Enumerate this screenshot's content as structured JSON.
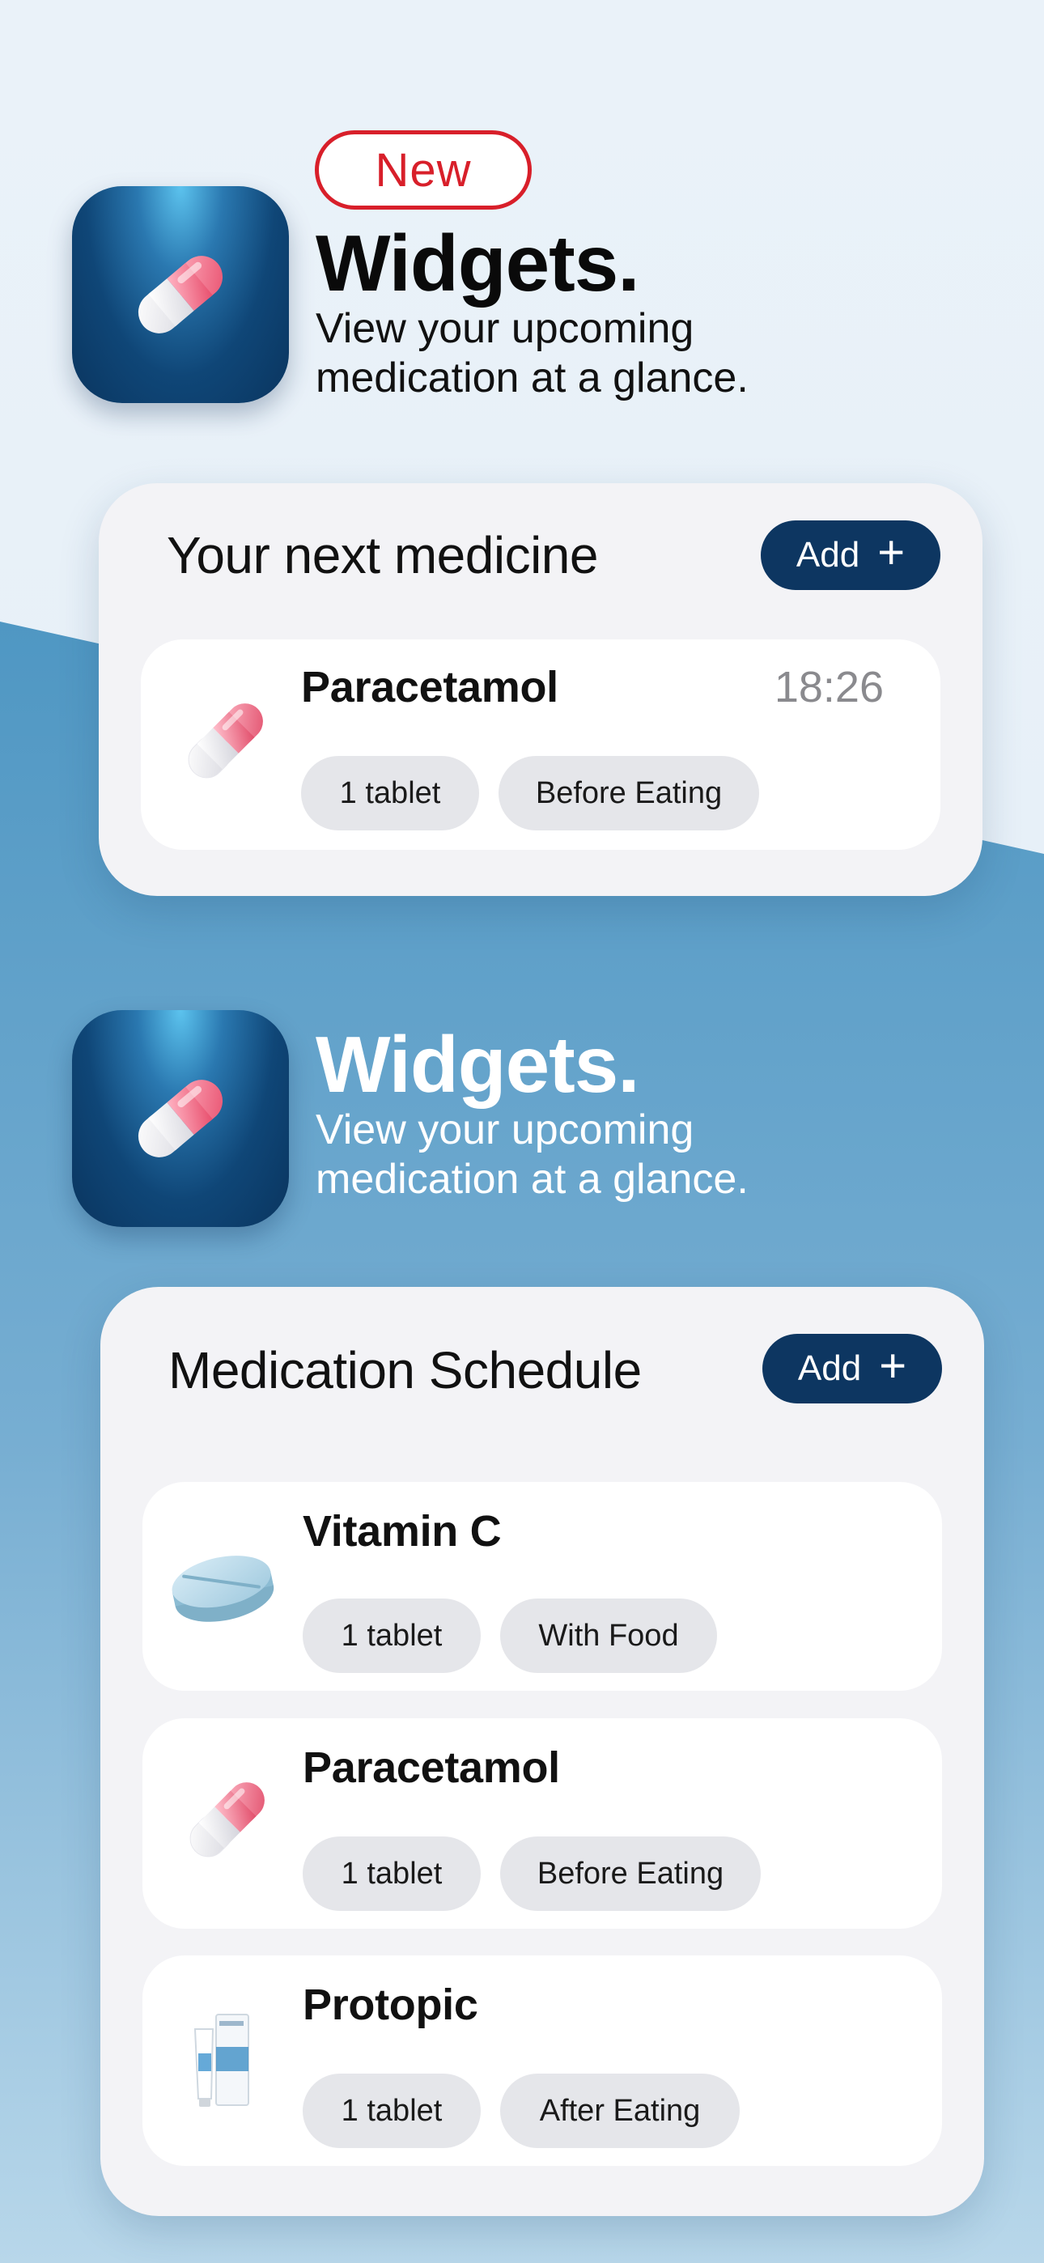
{
  "promo_top": {
    "badge": "New",
    "title": "Widgets.",
    "subtitle_line1": "View your upcoming",
    "subtitle_line2": "medication at a glance."
  },
  "widget_next": {
    "title": "Your next medicine",
    "add_label": "Add",
    "add_icon": "plus-icon",
    "medicine": {
      "name": "Paracetamol",
      "time": "18:26",
      "dose": "1 tablet",
      "instruction": "Before Eating",
      "icon": "capsule-icon"
    }
  },
  "promo_bottom": {
    "title": "Widgets.",
    "subtitle_line1": "View your upcoming",
    "subtitle_line2": "medication at a glance."
  },
  "widget_schedule": {
    "title": "Medication Schedule",
    "add_label": "Add",
    "add_icon": "plus-icon",
    "items": [
      {
        "name": "Vitamin C",
        "dose": "1 tablet",
        "instruction": "With Food",
        "icon": "tablet-icon"
      },
      {
        "name": "Paracetamol",
        "dose": "1 tablet",
        "instruction": "Before Eating",
        "icon": "capsule-icon"
      },
      {
        "name": "Protopic",
        "dose": "1 tablet",
        "instruction": "After Eating",
        "icon": "ointment-tube-icon"
      }
    ]
  },
  "colors": {
    "badge_red": "#d81f2a",
    "navy": "#0d3661",
    "chip_grey": "#e5e6ea",
    "card_bg": "#f3f3f6"
  }
}
